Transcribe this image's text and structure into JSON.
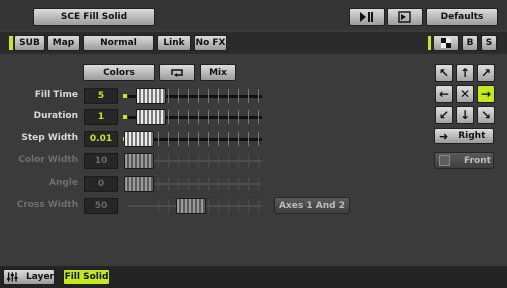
{
  "header": {
    "title": "SCE Fill Solid",
    "defaults_label": "Defaults"
  },
  "tabs": {
    "sub": "SUB",
    "map": "Map",
    "normal": "Normal",
    "link": "Link",
    "nofx": "No FX",
    "b": "B",
    "s": "S"
  },
  "top_buttons": {
    "colors": "Colors",
    "mix": "Mix"
  },
  "params": [
    {
      "label": "Fill Time",
      "value": "5",
      "enabled": true,
      "level": 0.0
    },
    {
      "label": "Duration",
      "value": "1",
      "enabled": true,
      "level": 0.0
    },
    {
      "label": "Step Width",
      "value": "0.01",
      "enabled": true,
      "level": 0.0
    },
    {
      "label": "Color Width",
      "value": "10",
      "enabled": false,
      "level": 0.0
    },
    {
      "label": "Angle",
      "value": "0",
      "enabled": false,
      "level": 0.0
    },
    {
      "label": "Cross Width",
      "value": "50",
      "enabled": false,
      "level": 0.5
    }
  ],
  "axes_button": "Axes 1 And 2",
  "direction": {
    "selected": "right",
    "label": "Right",
    "front_label": "Front"
  },
  "footer": {
    "layer_label": "Layer",
    "fill_label": "Fill Solid"
  },
  "colors": {
    "accent": "#c4ea1e",
    "panel": "#3b3b3b"
  }
}
